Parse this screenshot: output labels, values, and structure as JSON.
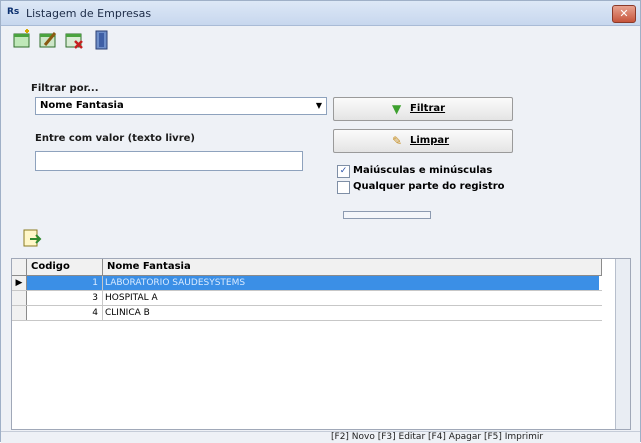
{
  "window": {
    "title": "Listagem de Empresas",
    "close_glyph": "✕"
  },
  "toolbar": {
    "buttons": [
      {
        "name": "novo-icon"
      },
      {
        "name": "editar-icon"
      },
      {
        "name": "apagar-icon"
      },
      {
        "name": "sair-icon"
      }
    ]
  },
  "filter": {
    "label": "Filtrar por...",
    "field_selected": "Nome Fantasia",
    "value_label": "Entre com valor (texto livre)",
    "value": "",
    "filter_button": "Filtrar",
    "clear_button": "Limpar",
    "case_checkbox_label": "Maiúsculas e minúsculas",
    "case_checked": true,
    "anypart_checkbox_label": "Qualquer parte do registro",
    "anypart_checked": false
  },
  "grid": {
    "columns": [
      "Codigo",
      "Nome Fantasia"
    ],
    "rows": [
      {
        "code": "1",
        "name": "LABORATORIO SAUDESYSTEMS",
        "selected": true
      },
      {
        "code": "3",
        "name": "HOSPITAL A",
        "selected": false
      },
      {
        "code": "4",
        "name": "CLINICA B",
        "selected": false
      }
    ],
    "current_row_marker": "▶"
  },
  "status": {
    "shortcuts": "[F2] Novo [F3] Editar [F4] Apagar [F5] Imprimir"
  },
  "colors": {
    "selection": "#3b8fe6",
    "accent_check": "#2950a8"
  }
}
